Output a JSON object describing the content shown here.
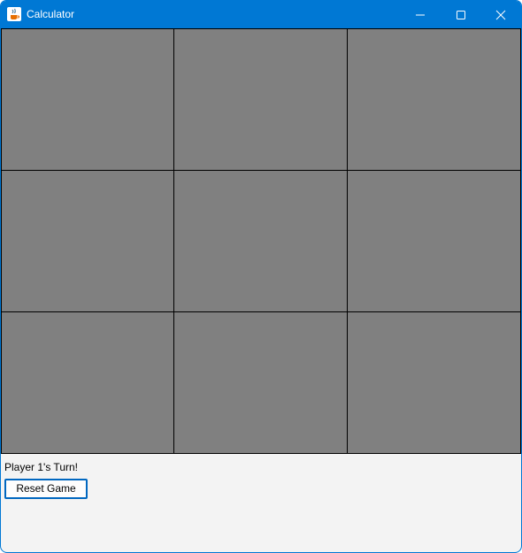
{
  "window": {
    "title": "Calculator",
    "icon": "java-cup-icon"
  },
  "title_controls": {
    "minimize_icon": "minimize-icon",
    "maximize_icon": "maximize-icon",
    "close_icon": "close-icon"
  },
  "board": {
    "cells": [
      "",
      "",
      "",
      "",
      "",
      "",
      "",
      "",
      ""
    ],
    "cell_color": "#808080"
  },
  "status_text": "Player 1's Turn!",
  "reset_label": "Reset Game",
  "colors": {
    "accent": "#0078d4",
    "button_border": "#0067c0",
    "window_background": "#f3f3f3"
  }
}
